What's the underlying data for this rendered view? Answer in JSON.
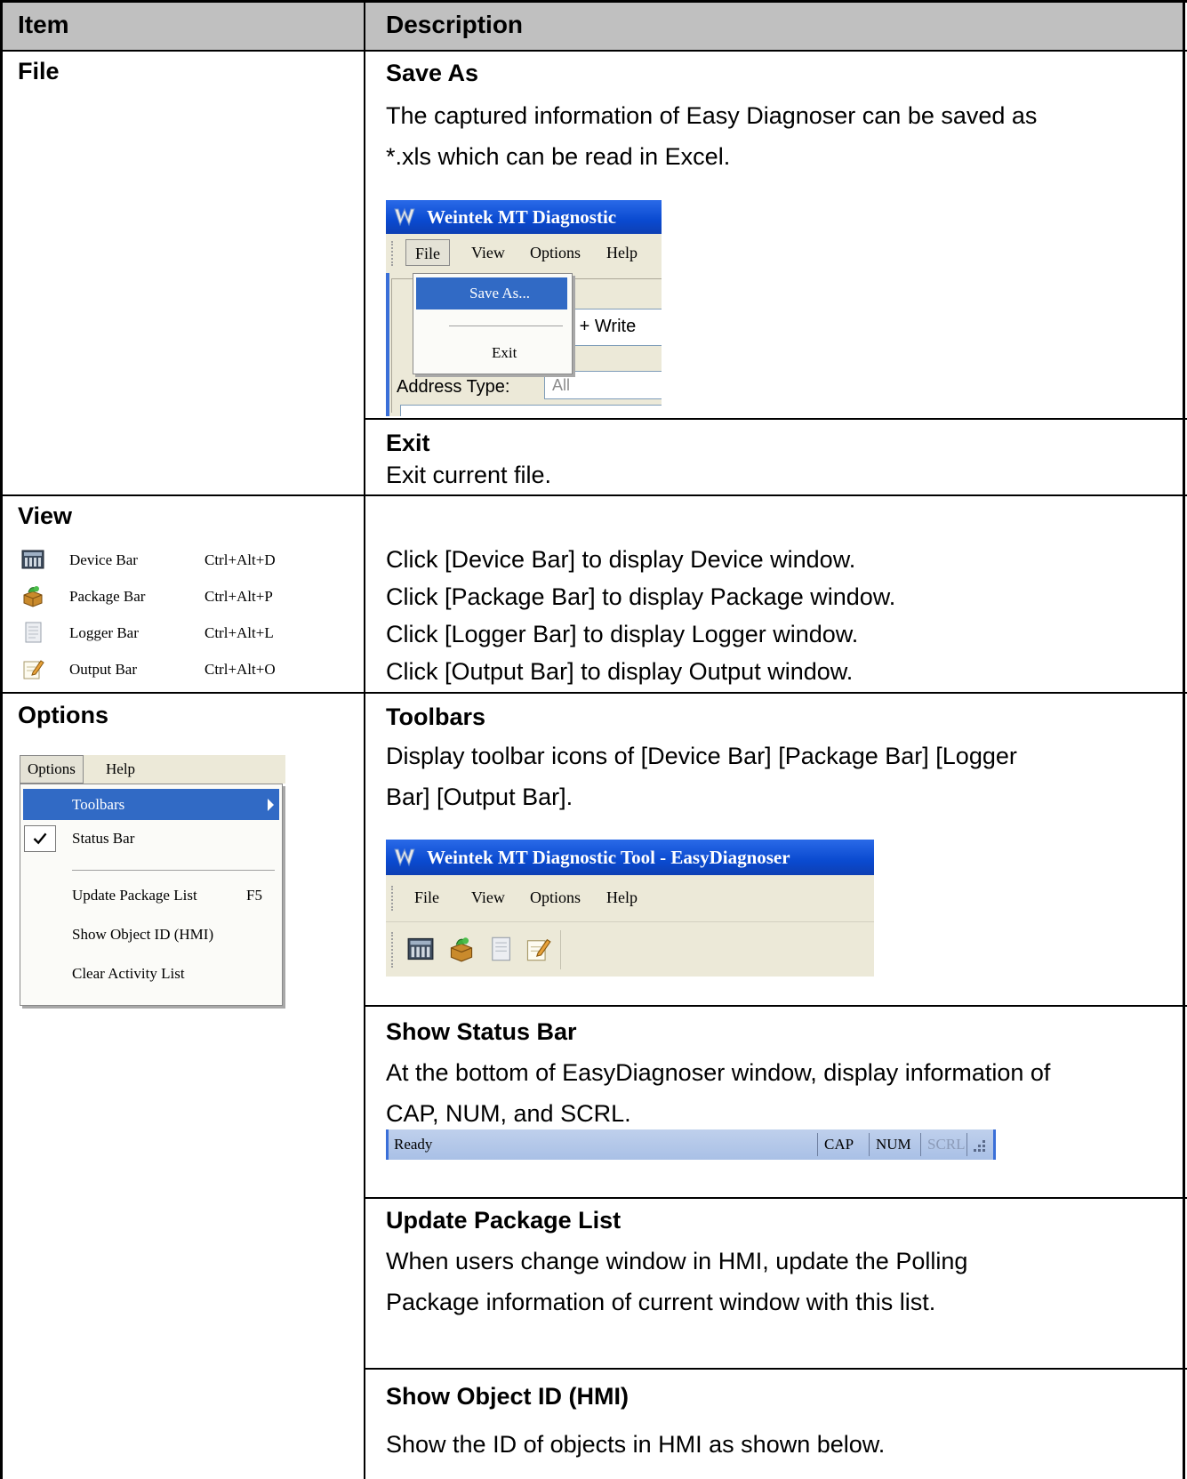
{
  "table": {
    "headers": [
      "Item",
      "Description"
    ]
  },
  "file": {
    "item": "File",
    "save_as": {
      "title": "Save As",
      "desc_line1": "The captured information of Easy Diagnoser can be saved as",
      "desc_line2": "*.xls which can be read in Excel."
    },
    "exit": {
      "title": "Exit",
      "desc": "Exit current file."
    },
    "screenshot": {
      "window_title": "Weintek MT Diagnostic",
      "menu": [
        "File",
        "View",
        "Options",
        "Help"
      ],
      "dropdown": [
        "Save As...",
        "Exit"
      ],
      "combo_text": "d + Write",
      "address_label": "Address Type:",
      "address_value": "All"
    }
  },
  "view": {
    "item": "View",
    "menu_items": [
      {
        "label": "Device Bar",
        "shortcut": "Ctrl+Alt+D",
        "icon": "device-bar-icon"
      },
      {
        "label": "Package Bar",
        "shortcut": "Ctrl+Alt+P",
        "icon": "package-bar-icon"
      },
      {
        "label": "Logger Bar",
        "shortcut": "Ctrl+Alt+L",
        "icon": "logger-bar-icon"
      },
      {
        "label": "Output Bar",
        "shortcut": "Ctrl+Alt+O",
        "icon": "output-bar-icon"
      }
    ],
    "descriptions": [
      "Click [Device Bar] to display Device window.",
      "Click [Package Bar] to display Package window.",
      "Click [Logger Bar] to display Logger window.",
      "Click [Output Bar] to display Output window."
    ]
  },
  "options": {
    "item": "Options",
    "menu": {
      "bar": [
        "Options",
        "Help"
      ],
      "items": [
        "Toolbars",
        "Status Bar",
        "Update Package List",
        "Show Object ID (HMI)",
        "Clear Activity List"
      ],
      "update_shortcut": "F5"
    },
    "toolbars": {
      "title": "Toolbars",
      "desc_line1": "Display toolbar icons of [Device Bar] [Package Bar] [Logger",
      "desc_line2": "Bar] [Output Bar].",
      "window_title": "Weintek MT Diagnostic Tool - EasyDiagnoser",
      "menu": [
        "File",
        "View",
        "Options",
        "Help"
      ]
    },
    "status_bar": {
      "title": "Show Status Bar",
      "desc_line1": "At the bottom of EasyDiagnoser window, display information of",
      "desc_line2": "CAP, NUM, and SCRL.",
      "bar_ready": "Ready",
      "bar_cap": "CAP",
      "bar_num": "NUM",
      "bar_scrl": "SCRL"
    },
    "update_package": {
      "title": "Update Package List",
      "desc_line1": "When users change window in HMI, update the Polling",
      "desc_line2": "Package information of current window with this list."
    },
    "show_object_id": {
      "title": "Show Object ID (HMI)",
      "desc": "Show the ID of objects in HMI as shown below."
    }
  },
  "colors": {
    "header_bg": "#c0c0c0",
    "xp_blue": "#316ac5",
    "menu_bg": "#ece9d8"
  }
}
